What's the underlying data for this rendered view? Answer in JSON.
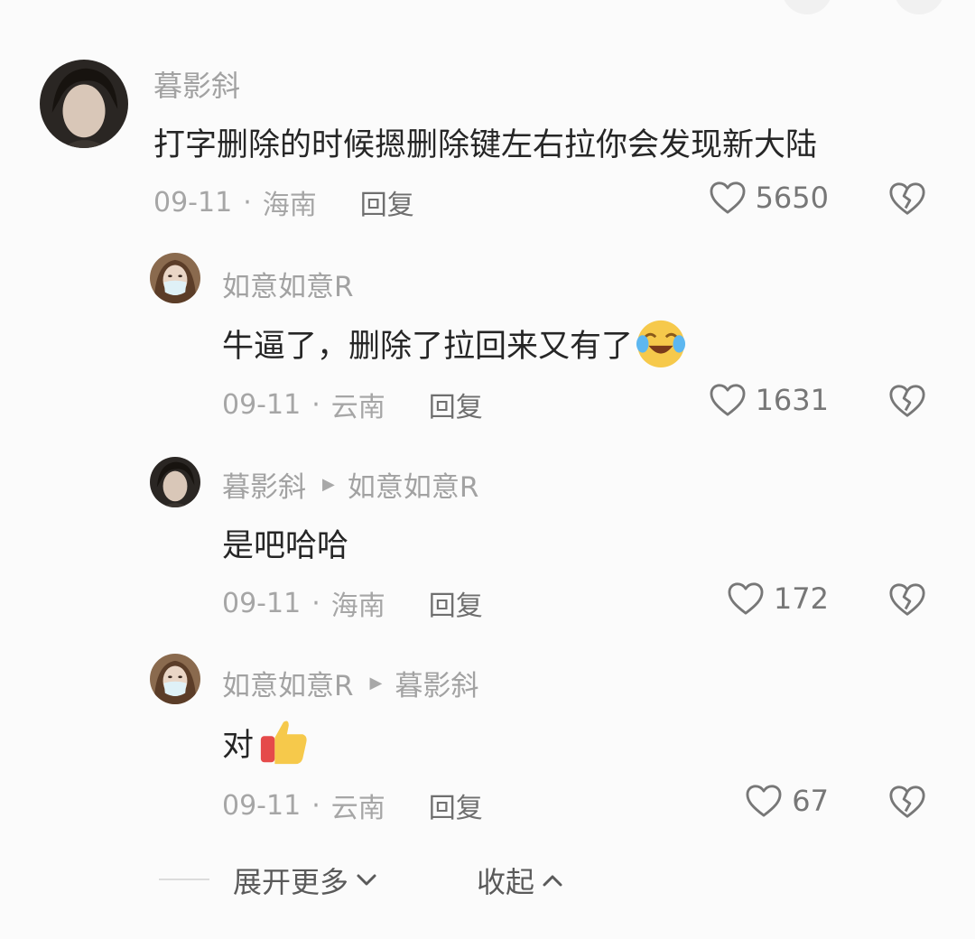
{
  "comments": [
    {
      "author": "暮影斜",
      "text": "打字删除的时候摁删除键左右拉你会发现新大陆",
      "date": "09-11",
      "location": "海南",
      "reply_label": "回复",
      "likes": "5650",
      "avatar_icon": "dark-hair-avatar"
    },
    {
      "author": "如意如意R",
      "text": "牛逼了，删除了拉回来又有了",
      "emoji": "crying-laughing-emoji",
      "date": "09-11",
      "location": "云南",
      "reply_label": "回复",
      "likes": "1631",
      "avatar_icon": "masked-girl-avatar"
    },
    {
      "author": "暮影斜",
      "reply_to": "如意如意R",
      "text": "是吧哈哈",
      "date": "09-11",
      "location": "海南",
      "reply_label": "回复",
      "likes": "172",
      "avatar_icon": "dark-hair-avatar"
    },
    {
      "author": "如意如意R",
      "reply_to": "暮影斜",
      "text": "对",
      "emoji": "thumbs-up-emoji",
      "date": "09-11",
      "location": "云南",
      "reply_label": "回复",
      "likes": "67",
      "avatar_icon": "masked-girl-avatar"
    }
  ],
  "footer": {
    "expand_label": "展开更多",
    "collapse_label": "收起"
  },
  "colors": {
    "background": "#fbfbfb",
    "text": "#262626",
    "muted": "#a6a6a6",
    "reply": "#6f6f6f"
  }
}
